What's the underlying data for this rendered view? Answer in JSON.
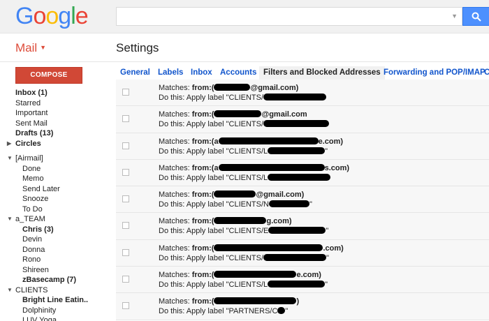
{
  "header": {
    "logo_text": "Google",
    "search": {
      "value": "",
      "placeholder": ""
    }
  },
  "app": {
    "mail_label": "Mail",
    "page_title": "Settings"
  },
  "sidebar": {
    "compose_label": "COMPOSE",
    "items": [
      {
        "label": "Inbox (1)",
        "bold": true
      },
      {
        "label": "Starred"
      },
      {
        "label": "Important"
      },
      {
        "label": "Sent Mail"
      },
      {
        "label": "Drafts (13)",
        "bold": true
      },
      {
        "label": "Circles",
        "bold": true
      },
      {
        "label": ""
      },
      {
        "label": "[Airmail]"
      },
      {
        "label": "Done"
      },
      {
        "label": "Memo"
      },
      {
        "label": "Send Later"
      },
      {
        "label": "Snooze"
      },
      {
        "label": "To Do"
      },
      {
        "label": "a_TEAM"
      },
      {
        "label": "Chris (3)",
        "bold": true
      },
      {
        "label": "Devin"
      },
      {
        "label": "Donna"
      },
      {
        "label": "Rono"
      },
      {
        "label": "Shireen"
      },
      {
        "label": "zBasecamp (7)",
        "bold": true
      },
      {
        "label": "CLIENTS"
      },
      {
        "label": "Bright Line Eatin..",
        "bold": true
      },
      {
        "label": "Dolphinity"
      },
      {
        "label": "LUV Yoga"
      }
    ]
  },
  "tabs": [
    {
      "label": "General"
    },
    {
      "label": "Labels"
    },
    {
      "label": "Inbox"
    },
    {
      "label": "Accounts"
    },
    {
      "label": "Filters and Blocked Addresses",
      "active": true
    },
    {
      "label": "Forwarding and POP/IMAP"
    },
    {
      "label": "C"
    }
  ],
  "filters": {
    "matches_prefix": "Matches: ",
    "from_keyword": "from:",
    "action_prefix": "Do this: Apply label ",
    "rows": [
      {
        "from_open": "(",
        "from_close": "@gmail.com)",
        "label_open": "\"CLIENTS/",
        "label_close": ""
      },
      {
        "from_open": "(",
        "from_close": "@gmail.com",
        "label_open": "\"CLIENTS/",
        "label_close": ""
      },
      {
        "from_open": "(a",
        "from_close": "e.com)",
        "label_open": "\"CLIENTS/L",
        "label_close": "\""
      },
      {
        "from_open": "(a",
        "from_close": "s.com)",
        "label_open": "\"CLIENTS/L",
        "label_close": ""
      },
      {
        "from_open": "(",
        "from_close": "@gmail.com)",
        "label_open": "\"CLIENTS/N",
        "label_close": "\""
      },
      {
        "from_open": "(",
        "from_close": "g.com)",
        "label_open": "\"CLIENTS/E",
        "label_close": "\""
      },
      {
        "from_open": "(",
        "from_close": ".com)",
        "label_open": "\"CLIENTS/",
        "label_close": "\""
      },
      {
        "from_open": "(",
        "from_close": "e.com)",
        "label_open": "\"CLIENTS/L",
        "label_close": "\""
      },
      {
        "from_open": "(",
        "from_close": ")",
        "label_open": "\"PARTNERS/C",
        "label_close": "\""
      }
    ]
  },
  "colors": {
    "brand_red": "#dd4b39",
    "compose_red": "#d14836",
    "link_blue": "#15c",
    "search_blue": "#4d90fe"
  },
  "icons": {
    "search_button": "search-icon",
    "collapse_arrow": "triangle-down-icon",
    "expand_arrow": "triangle-right-icon"
  }
}
